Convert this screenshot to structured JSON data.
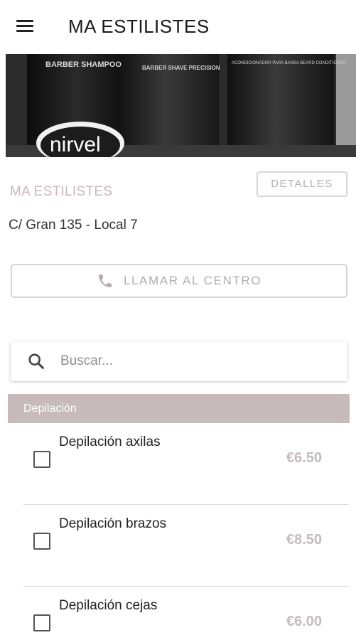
{
  "app": {
    "title": "MA ESTILISTES"
  },
  "banner": {
    "products": [
      "BARBER SHAMPOO",
      "BARBER SHAVE PRECISION",
      "ACONDICIONADOR PARA BARBA BEARD CONDITIONER"
    ],
    "brand": "nirvel"
  },
  "shop": {
    "name": "MA ESTILISTES",
    "details_label": "DETALLES",
    "address": "C/ Gran 135 - Local 7",
    "call_label": "LLAMAR AL CENTRO"
  },
  "search": {
    "placeholder": "Buscar..."
  },
  "category": {
    "title": "Depilación"
  },
  "services": [
    {
      "name": "Depilación axilas",
      "price": "€6.50",
      "checked": false
    },
    {
      "name": "Depilación brazos",
      "price": "€8.50",
      "checked": false
    },
    {
      "name": "Depilación cejas",
      "price": "€6.00",
      "checked": false
    }
  ],
  "colors": {
    "accent": "#c7baba",
    "muted_text": "#c9b8bb",
    "price": "#c4bbbc"
  }
}
